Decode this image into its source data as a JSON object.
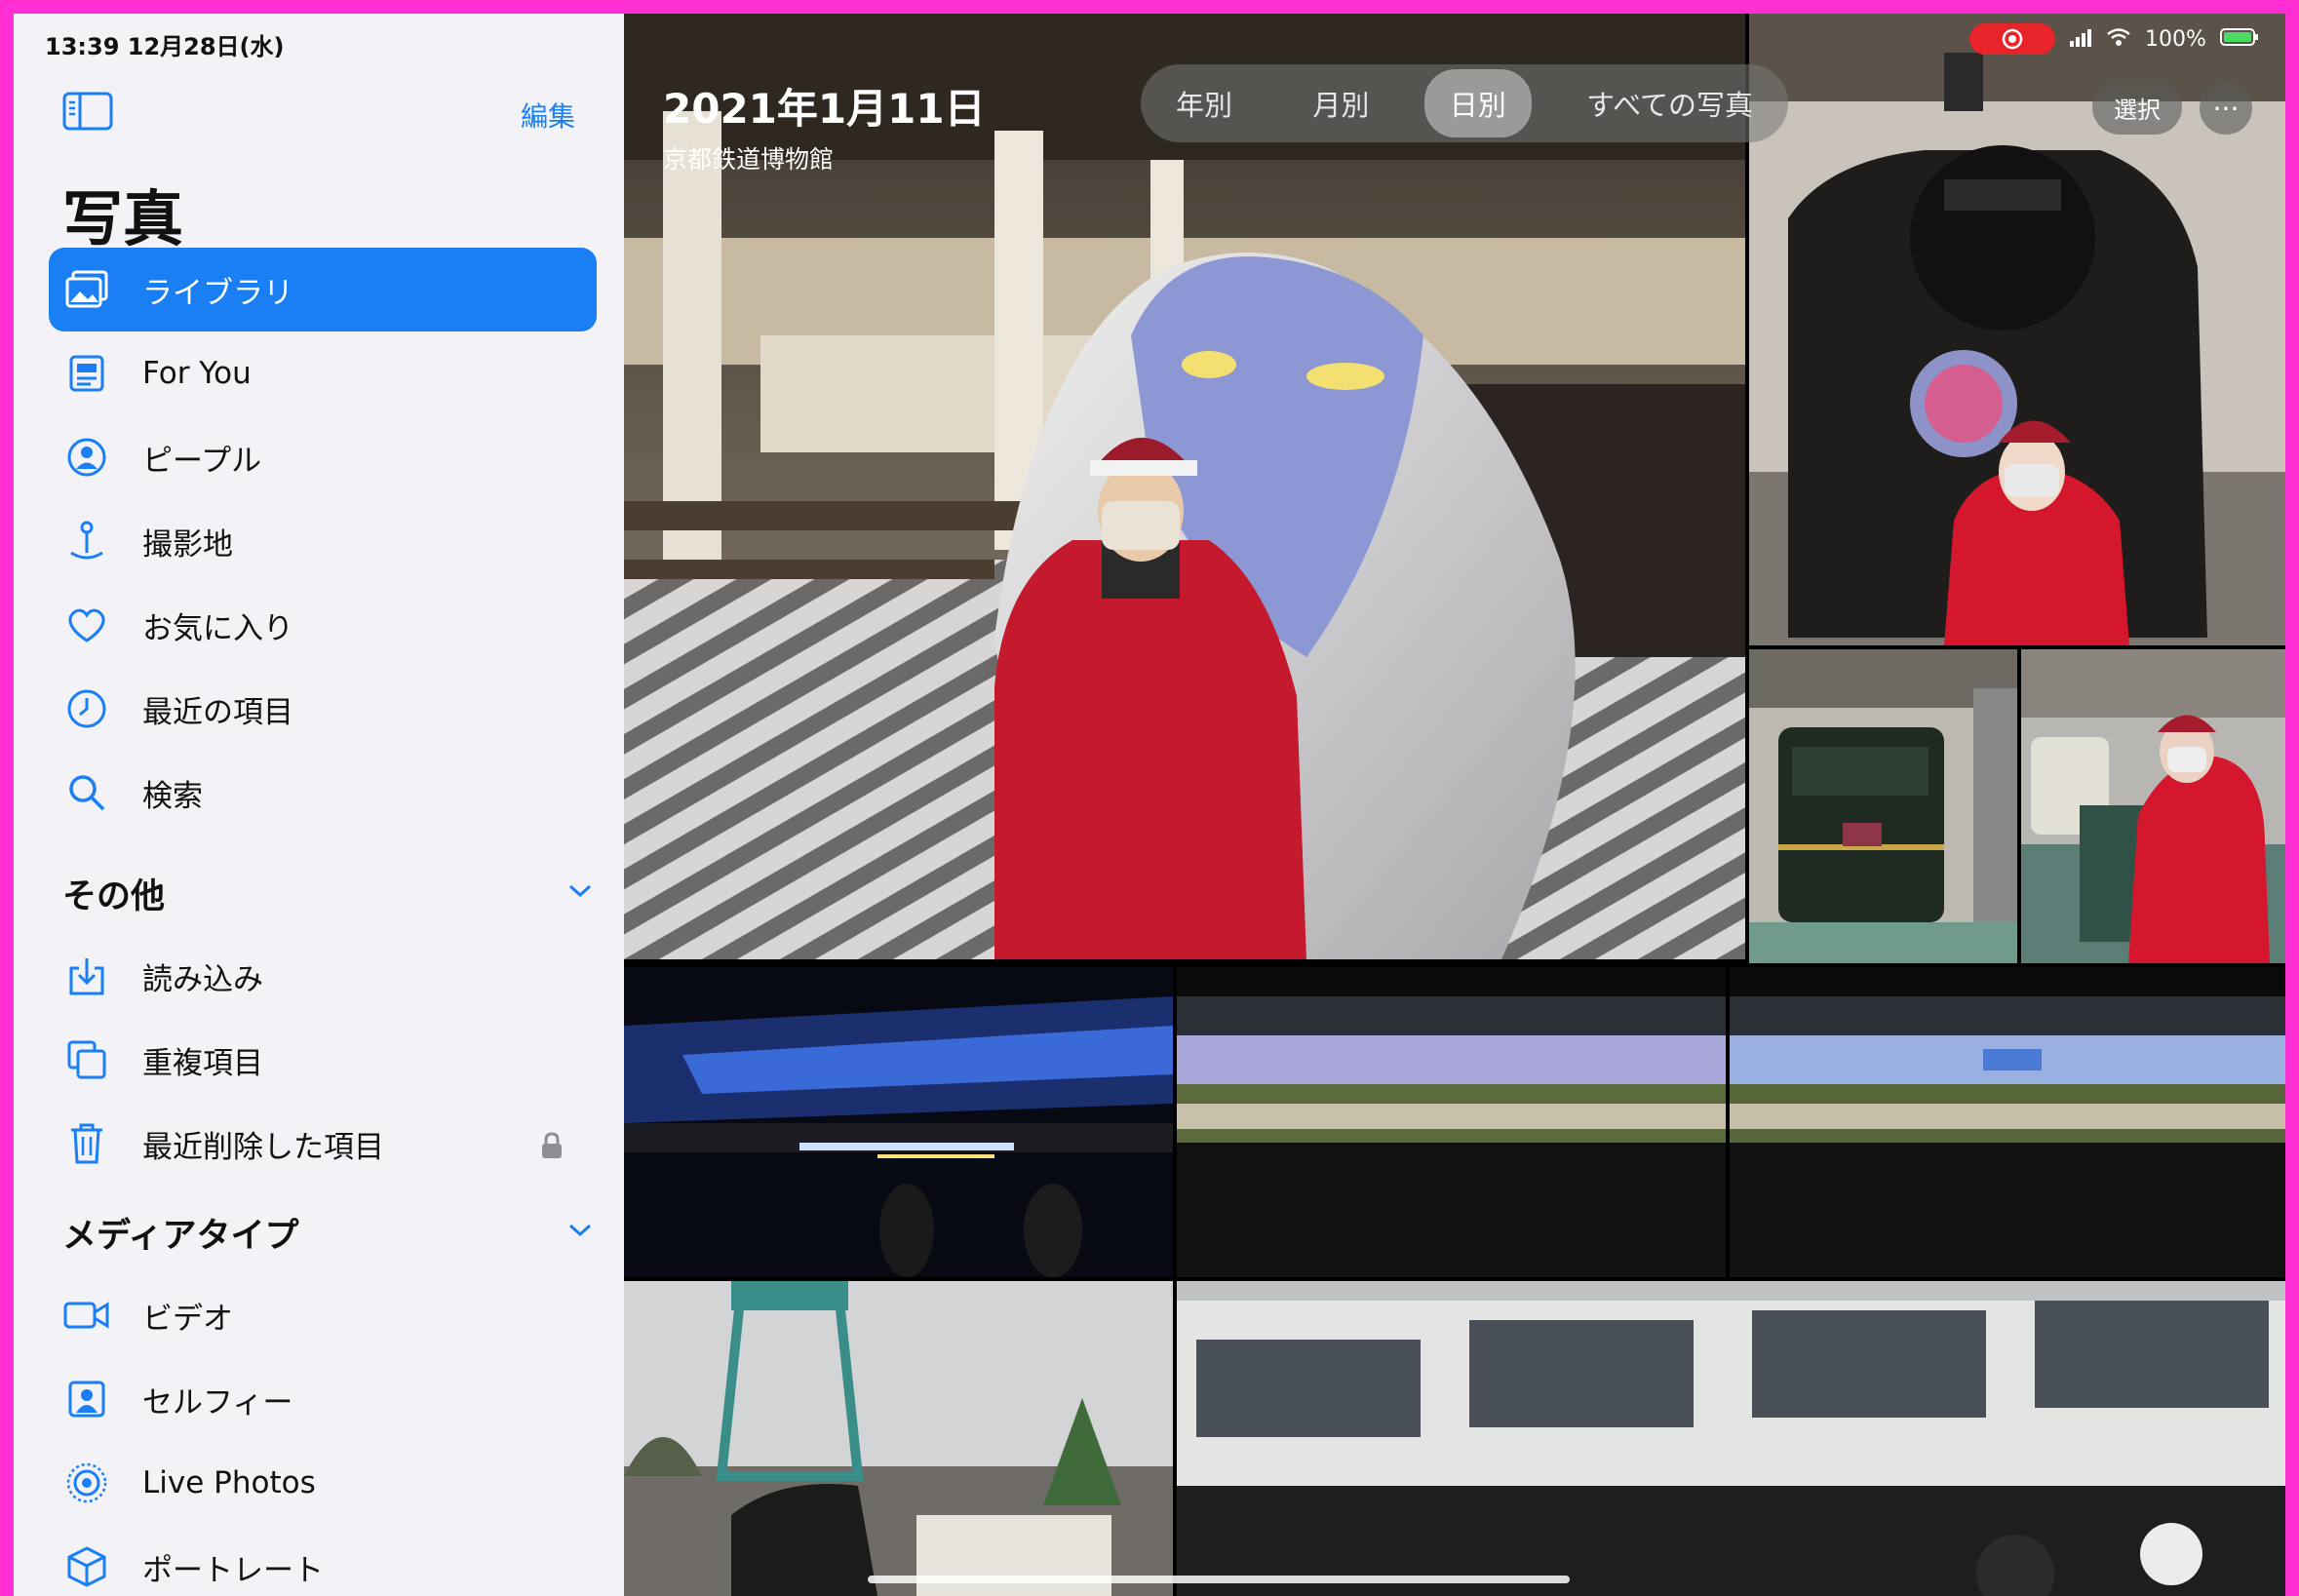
{
  "status": {
    "time_date": "13:39  12月28日(水)",
    "battery": "100%",
    "record_color": "#e8242b"
  },
  "sidebar": {
    "edit_label": "編集",
    "title": "写真",
    "items": [
      {
        "label": "ライブラリ",
        "icon": "library-icon",
        "active": true
      },
      {
        "label": "For You",
        "icon": "for-you-icon"
      },
      {
        "label": "ピープル",
        "icon": "people-icon"
      },
      {
        "label": "撮影地",
        "icon": "location-pin-icon"
      },
      {
        "label": "お気に入り",
        "icon": "heart-icon"
      },
      {
        "label": "最近の項目",
        "icon": "clock-icon"
      },
      {
        "label": "検索",
        "icon": "search-icon"
      }
    ],
    "section_other": "その他",
    "other_items": [
      {
        "label": "読み込み",
        "icon": "import-icon"
      },
      {
        "label": "重複項目",
        "icon": "duplicates-icon"
      },
      {
        "label": "最近削除した項目",
        "icon": "trash-icon"
      }
    ],
    "section_media": "メディアタイプ",
    "media_items": [
      {
        "label": "ビデオ",
        "icon": "video-icon"
      },
      {
        "label": "セルフィー",
        "icon": "selfie-icon"
      },
      {
        "label": "Live Photos",
        "icon": "live-photos-icon"
      },
      {
        "label": "ポートレート",
        "icon": "portrait-cube-icon"
      }
    ],
    "accent": "#1a7ef5"
  },
  "main": {
    "date_title": "2021年1月11日",
    "place": "京都鉄道博物館",
    "segments": [
      "年別",
      "月別",
      "日別",
      "すべての写真"
    ],
    "active_segment": "日別",
    "select_label": "選択",
    "more_label": "···"
  }
}
